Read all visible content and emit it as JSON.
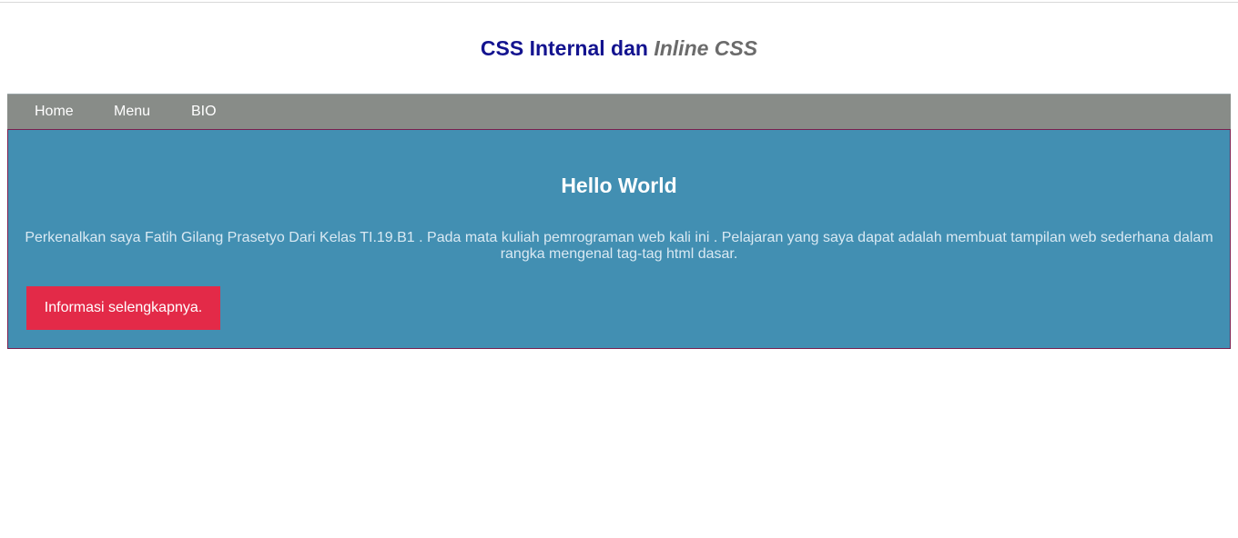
{
  "header": {
    "title_main": "CSS Internal dan",
    "title_inline": "Inline",
    "title_css": "CSS"
  },
  "nav": {
    "items": [
      {
        "label": "Home"
      },
      {
        "label": "Menu"
      },
      {
        "label": "BIO"
      }
    ]
  },
  "hero": {
    "heading": "Hello World",
    "text": "Perkenalkan saya Fatih Gilang Prasetyo Dari Kelas TI.19.B1 . Pada mata kuliah pemrograman web kali ini . Pelajaran yang saya dapat adalah membuat tampilan web sederhana dalam rangka mengenal tag-tag html dasar.",
    "button_label": "Informasi selengkapnya."
  },
  "colors": {
    "title_blue": "#13138f",
    "title_gray": "#6b6b6b",
    "navbar_bg": "#888c88",
    "hero_bg": "#428fb2",
    "button_bg": "#e32a48"
  }
}
